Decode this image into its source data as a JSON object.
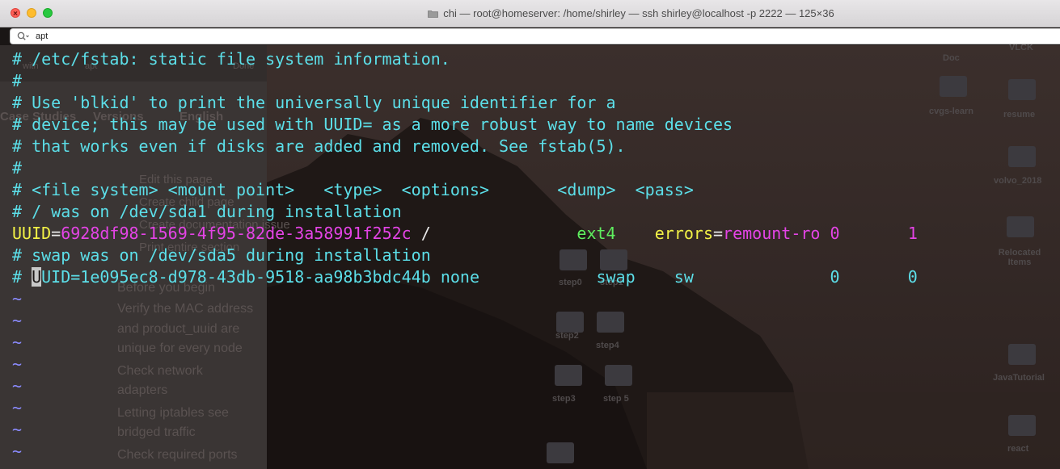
{
  "window": {
    "title": "chi — root@homeserver: /home/shirley — ssh shirley@localhost -p 2222 — 125×36"
  },
  "search": {
    "value": "apt",
    "placeholder": ""
  },
  "background": {
    "sidebar": {
      "header_items": [
        "with",
        "apt",
        "Done"
      ],
      "ghost_lines": [
        "Case Studies",
        "Versions",
        "English",
        "Edit this page",
        "Create child page",
        "Create documentation issue",
        "Print entire section",
        "Before you begin",
        "Verify the MAC address",
        "and product_uuid are",
        "unique for every node",
        "Check network",
        "adapters",
        "Letting iptables see",
        "bridged traffic",
        "Check required ports"
      ]
    },
    "desktop_icons": [
      {
        "label": "Doc"
      },
      {
        "label": "VLCK"
      },
      {
        "label": "cvgs-learn"
      },
      {
        "label": "resume"
      },
      {
        "label": "volvo_2018"
      },
      {
        "label": "Relocated Items"
      },
      {
        "label": "step0"
      },
      {
        "label": "step1"
      },
      {
        "label": "step2"
      },
      {
        "label": "step4"
      },
      {
        "label": "step3"
      },
      {
        "label": "step 5"
      },
      {
        "label": "JavaTutorial"
      },
      {
        "label": "react"
      }
    ]
  },
  "terminal": {
    "colors": {
      "comment": "#5cdfe9",
      "keyword": "#f2f246",
      "value": "#e444e6",
      "type": "#5fef5f",
      "plain": "#e9e9e9",
      "tilde": "#8b8bff"
    },
    "lines": [
      {
        "text": "# /etc/fstab: static file system information."
      },
      {
        "text": "#"
      },
      {
        "text": "# Use 'blkid' to print the universally unique identifier for a"
      },
      {
        "text": "# device; this may be used with UUID= as a more robust way to name devices"
      },
      {
        "text": "# that works even if disks are added and removed. See fstab(5)."
      },
      {
        "text": "#"
      },
      {
        "text": "# <file system> <mount point>   <type>  <options>       <dump>  <pass>"
      },
      {
        "text": "# / was on /dev/sda1 during installation"
      },
      {
        "uuid_key": "UUID",
        "eq": "=",
        "uuid_value": "6928df98-1569-4f95-82de-3a58991f252c",
        "mount": " /               ",
        "fstype": "ext4",
        "gap": "    ",
        "opt_key": "errors",
        "opt_eq": "=",
        "opt_value": "remount-ro",
        "dump": " 0",
        "pass": "       1"
      },
      {
        "text": "# swap was on /dev/sda5 during installation"
      },
      {
        "prefix": "# ",
        "cursor_char": "U",
        "rest": "UID=1e095ec8-d978-43db-9518-aa98b3bdc44b none            swap    sw              0       0"
      },
      {
        "text": "~"
      },
      {
        "text": "~"
      },
      {
        "text": "~"
      },
      {
        "text": "~"
      },
      {
        "text": "~"
      },
      {
        "text": "~"
      },
      {
        "text": "~"
      },
      {
        "text": "~"
      }
    ]
  }
}
